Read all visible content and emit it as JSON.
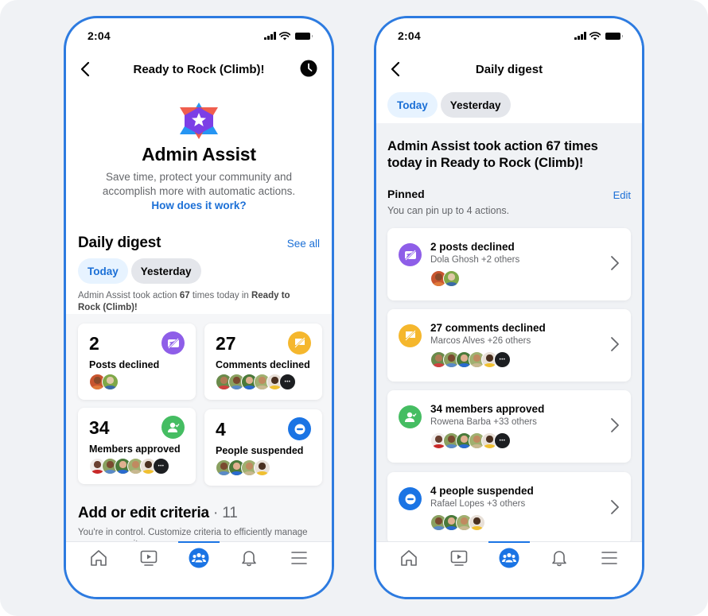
{
  "colors": {
    "accent": "#1b74e4",
    "frame": "#2d7be0",
    "posts_declined": "#8e5ee8",
    "comments_declined": "#f5b72d",
    "members_approved": "#45bd62",
    "people_suspended": "#1b74e4"
  },
  "left_phone": {
    "status_bar": {
      "time": "2:04",
      "icons": [
        "signal-icon",
        "wifi-icon",
        "battery-icon"
      ]
    },
    "header": {
      "back_icon": "chevron-left-icon",
      "title": "Ready to Rock (Climb)!",
      "right_icon": "clock-icon"
    },
    "hero": {
      "logo_icon": "admin-assist-star-icon",
      "title": "Admin Assist",
      "subtitle": "Save time, protect your community and accomplish more with automatic actions.",
      "link": "How does it work?"
    },
    "daily_digest": {
      "title": "Daily digest",
      "see_all": "See all",
      "chips": [
        {
          "label": "Today",
          "active": true
        },
        {
          "label": "Yesterday",
          "active": false
        }
      ],
      "summary_prefix": "Admin Assist took action ",
      "summary_count": "67",
      "summary_middle": " times today in ",
      "summary_group": "Ready to Rock (Climb)!",
      "stats": [
        {
          "value": "2",
          "label": "Posts declined",
          "icon": "post-declined-icon",
          "avatar_count": 2,
          "has_more": false
        },
        {
          "value": "27",
          "label": "Comments declined",
          "icon": "comment-declined-icon",
          "avatar_count": 5,
          "has_more": true
        },
        {
          "value": "34",
          "label": "Members approved",
          "icon": "member-approved-icon",
          "avatar_count": 5,
          "has_more": true
        },
        {
          "value": "4",
          "label": "People suspended",
          "icon": "suspended-icon",
          "avatar_count": 4,
          "has_more": false
        }
      ]
    },
    "criteria": {
      "title": "Add or edit criteria",
      "count": "11",
      "separator": " · ",
      "subtitle": "You're in control. Customize criteria to efficiently manage your community."
    }
  },
  "right_phone": {
    "status_bar": {
      "time": "2:04"
    },
    "header": {
      "back_icon": "chevron-left-icon",
      "title": "Daily digest"
    },
    "chips": [
      {
        "label": "Today",
        "active": true
      },
      {
        "label": "Yesterday",
        "active": false
      }
    ],
    "headline": "Admin Assist took action 67 times today in Ready to Rock (Climb)!",
    "pinned": {
      "title": "Pinned",
      "edit": "Edit",
      "subtitle": "You can pin up to 4 actions."
    },
    "rows": [
      {
        "title": "2 posts declined",
        "subtitle": "Dola Ghosh +2 others",
        "icon": "post-declined-icon",
        "avatar_count": 2,
        "has_more": false
      },
      {
        "title": "27 comments declined",
        "subtitle": "Marcos Alves +26 others",
        "icon": "comment-declined-icon",
        "avatar_count": 5,
        "has_more": true
      },
      {
        "title": "34 members approved",
        "subtitle": "Rowena Barba +33 others",
        "icon": "member-approved-icon",
        "avatar_count": 5,
        "has_more": true
      },
      {
        "title": "4 people suspended",
        "subtitle": "Rafael Lopes +3 others",
        "icon": "suspended-icon",
        "avatar_count": 4,
        "has_more": false
      }
    ]
  },
  "tab_bar": {
    "tabs": [
      {
        "name": "home",
        "icon": "home-icon",
        "active": false
      },
      {
        "name": "watch",
        "icon": "video-icon",
        "active": false
      },
      {
        "name": "groups",
        "icon": "groups-icon",
        "active": true
      },
      {
        "name": "notifications",
        "icon": "bell-icon",
        "active": false
      },
      {
        "name": "menu",
        "icon": "menu-icon",
        "active": false
      }
    ]
  }
}
